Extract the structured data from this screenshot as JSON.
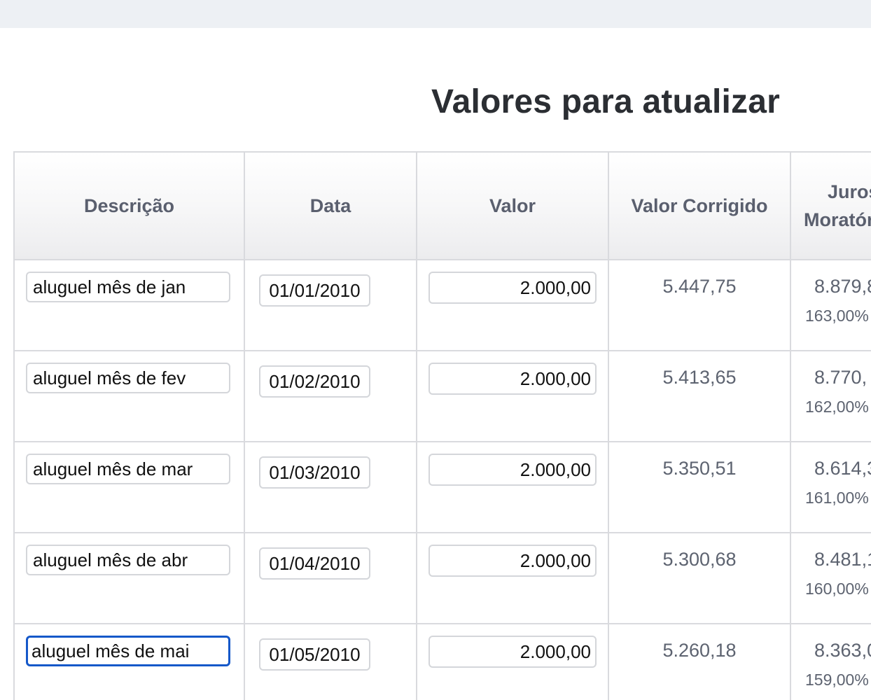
{
  "header": {
    "title": "Valores para atualizar"
  },
  "table": {
    "columns": {
      "descricao": "Descrição",
      "data": "Data",
      "valor": "Valor",
      "valor_corrigido": "Valor Corrigido",
      "juros_line1": "Juros",
      "juros_line2": "Moratórios"
    },
    "rows": [
      {
        "descricao": "aluguel mês de jan",
        "data": "01/01/2010",
        "valor": "2.000,00",
        "valor_corrigido": "5.447,75",
        "juros": "8.879,8",
        "juros_pct": "163,00%"
      },
      {
        "descricao": "aluguel mês de fev",
        "data": "01/02/2010",
        "valor": "2.000,00",
        "valor_corrigido": "5.413,65",
        "juros": "8.770,",
        "juros_pct": "162,00%"
      },
      {
        "descricao": "aluguel mês de mar",
        "data": "01/03/2010",
        "valor": "2.000,00",
        "valor_corrigido": "5.350,51",
        "juros": "8.614,3",
        "juros_pct": "161,00%"
      },
      {
        "descricao": "aluguel mês de abr",
        "data": "01/04/2010",
        "valor": "2.000,00",
        "valor_corrigido": "5.300,68",
        "juros": "8.481,1",
        "juros_pct": "160,00%"
      },
      {
        "descricao": "aluguel mês de mai",
        "data": "01/05/2010",
        "valor": "2.000,00",
        "valor_corrigido": "5.260,18",
        "juros": "8.363,0",
        "juros_pct": "159,00%"
      }
    ]
  },
  "colors": {
    "focus_border": "#1558c9",
    "muted_text": "#5d6370",
    "header_text": "#5a5f6e"
  }
}
